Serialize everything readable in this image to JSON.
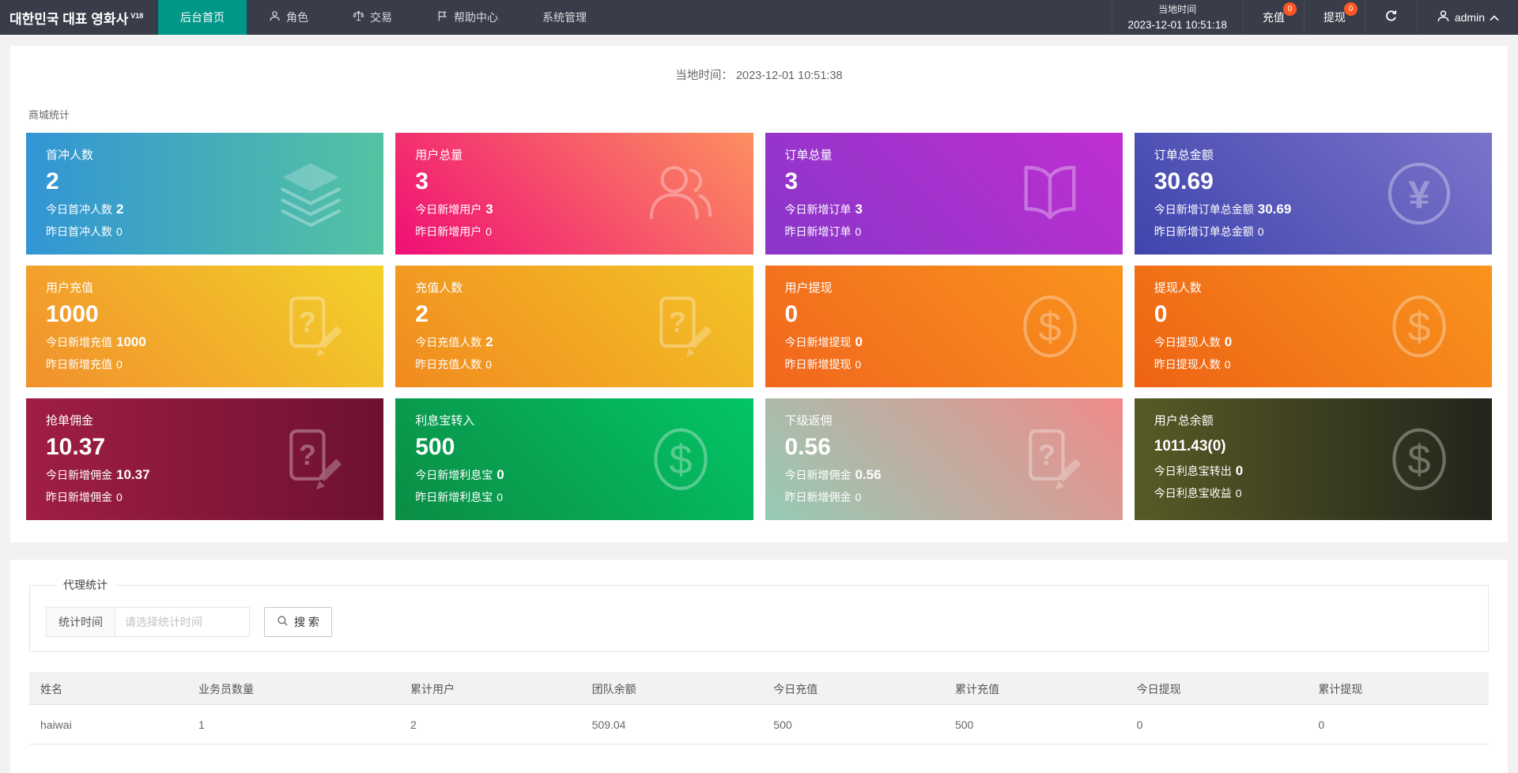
{
  "navbar": {
    "logo": "대한민국 대표 영화사",
    "logo_version": "V18",
    "menu": [
      {
        "label": "后台首页",
        "active": true
      },
      {
        "label": "角色",
        "icon": "person-icon"
      },
      {
        "label": "交易",
        "icon": "scales-icon"
      },
      {
        "label": "帮助中心",
        "icon": "flag-icon"
      },
      {
        "label": "系统管理"
      }
    ],
    "local_time_label": "当地时间",
    "local_time_value": "2023-12-01 10:51:18",
    "recharge": {
      "label": "充值",
      "badge": "0"
    },
    "withdraw": {
      "label": "提现",
      "badge": "0"
    },
    "username": "admin",
    "colors": {
      "navbar_bg": "#393D49",
      "active_bg": "#009688",
      "badge_bg": "#FF5722"
    }
  },
  "main": {
    "local_time_label": "当地时间：",
    "local_time_value": "2023-12-01 10:51:38",
    "section_title": "商城统计",
    "cards": [
      {
        "title": "首冲人数",
        "value": "2",
        "line2_label": "今日首冲人数",
        "line2_value": "2",
        "line3_label": "昨日首冲人数",
        "line3_value": "0",
        "icon": "layers-icon",
        "gradient": {
          "angle": 90,
          "from": "#3295d5",
          "to": "#54c3a2"
        }
      },
      {
        "title": "用户总量",
        "value": "3",
        "line2_label": "今日新增用户",
        "line2_value": "3",
        "line3_label": "昨日新增用户",
        "line3_value": "0",
        "icon": "users-icon",
        "gradient": {
          "angle": 45,
          "from": "#f00e76",
          "to": "#fc9060"
        }
      },
      {
        "title": "订单总量",
        "value": "3",
        "line2_label": "今日新增订单",
        "line2_value": "3",
        "line3_label": "昨日新增订单",
        "line3_value": "0",
        "icon": "book-icon",
        "gradient": {
          "angle": 45,
          "from": "#8936c9",
          "to": "#c02ed2"
        }
      },
      {
        "title": "订单总金额",
        "value": "30.69",
        "line2_label": "今日新增订单总金额",
        "line2_value": "30.69",
        "line3_label": "昨日新增订单总金额",
        "line3_value": "0",
        "icon": "yen-circle-icon",
        "gradient": {
          "angle": 45,
          "from": "#3f45ad",
          "to": "#7b74ca"
        }
      },
      {
        "title": "用户充值",
        "value": "1000",
        "line2_label": "今日新增充值",
        "line2_value": "1000",
        "line3_label": "昨日新增充值",
        "line3_value": "0",
        "icon": "doc-question-icon",
        "gradient": {
          "angle": 45,
          "from": "#f1902c",
          "to": "#f3d12a"
        }
      },
      {
        "title": "充值人数",
        "value": "2",
        "line2_label": "今日充值人数",
        "line2_value": "2",
        "line3_label": "昨日充值人数",
        "line3_value": "0",
        "icon": "doc-question-icon",
        "gradient": {
          "angle": 45,
          "from": "#f18a1f",
          "to": "#f3c428"
        }
      },
      {
        "title": "用户提现",
        "value": "0",
        "line2_label": "今日新增提现",
        "line2_value": "0",
        "line3_label": "昨日新增提现",
        "line3_value": "0",
        "icon": "dollar-circle-icon",
        "gradient": {
          "angle": 45,
          "from": "#f2661d",
          "to": "#f8941d"
        }
      },
      {
        "title": "提现人数",
        "value": "0",
        "line2_label": "今日提现人数",
        "line2_value": "0",
        "line3_label": "昨日提现人数",
        "line3_value": "0",
        "icon": "dollar-circle-icon",
        "gradient": {
          "angle": 45,
          "from": "#ee6314",
          "to": "#f8941d"
        }
      },
      {
        "title": "抢单佣金",
        "value": "10.37",
        "line2_label": "今日新增佣金",
        "line2_value": "10.37",
        "line3_label": "昨日新增佣金",
        "line3_value": "0",
        "icon": "doc-question-icon",
        "gradient": {
          "angle": 90,
          "from": "#a01e44",
          "to": "#6d1130"
        }
      },
      {
        "title": "利息宝转入",
        "value": "500",
        "line2_label": "今日新增利息宝",
        "line2_value": "0",
        "line3_label": "昨日新增利息宝",
        "line3_value": "0",
        "icon": "dollar-circle-icon",
        "gradient": {
          "angle": 45,
          "from": "#0b8c45",
          "to": "#03c566"
        }
      },
      {
        "title": "下级返佣",
        "value": "0.56",
        "line2_label": "今日新增佣金",
        "line2_value": "0.56",
        "line3_label": "昨日新增佣金",
        "line3_value": "0",
        "icon": "doc-question-icon",
        "gradient": {
          "angle": 45,
          "from": "#95cbb4",
          "to": "#f08b8b"
        }
      },
      {
        "title": "用户总余额",
        "value": "1011.43(0)",
        "line2_label": "今日利息宝转出",
        "line2_value": "0",
        "line3_label": "今日利息宝收益",
        "line3_value": "0",
        "icon": "dollar-circle-icon",
        "gradient": {
          "angle": 90,
          "from": "#585a25",
          "to": "#21251b"
        }
      }
    ]
  },
  "agent": {
    "legend": "代理统计",
    "filter_label": "统计时间",
    "filter_placeholder": "请选择统计时间",
    "search_label": "搜 索",
    "table": {
      "headers": [
        "姓名",
        "业务员数量",
        "累计用户",
        "团队余额",
        "今日充值",
        "累计充值",
        "今日提现",
        "累计提现"
      ],
      "rows": [
        [
          "haiwai",
          "1",
          "2",
          "509.04",
          "500",
          "500",
          "0",
          "0"
        ]
      ]
    }
  }
}
